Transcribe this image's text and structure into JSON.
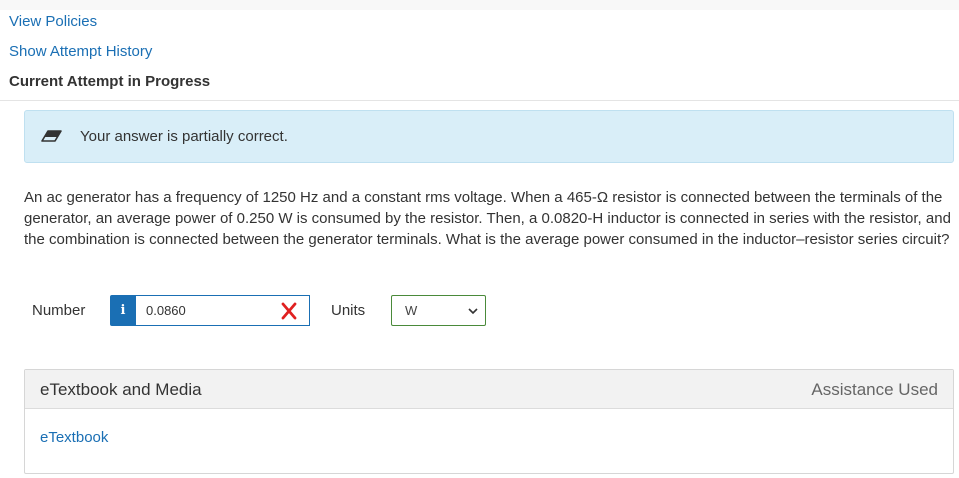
{
  "links": {
    "view_policies": "View Policies",
    "show_attempt_history": "Show Attempt History"
  },
  "attempt_heading": "Current Attempt in Progress",
  "alert": {
    "message": "Your answer is partially correct.",
    "icon": "pencil-icon"
  },
  "question": {
    "text": "An ac generator has a frequency of 1250 Hz and a constant rms voltage. When a 465-Ω resistor is connected between the terminals of the generator, an average power of 0.250 W is consumed by the resistor. Then, a 0.0820-H inductor is connected in series with the resistor, and the combination is connected between the generator terminals. What is the average power consumed in the inductor–resistor series circuit?"
  },
  "answer": {
    "number_label": "Number",
    "info_icon_glyph": "i",
    "value": "0.0860",
    "status_icon": "x-mark-icon",
    "units_label": "Units",
    "units_selected": "W"
  },
  "media": {
    "title": "eTextbook and Media",
    "assistance": "Assistance Used",
    "etextbook_link": "eTextbook"
  },
  "colors": {
    "link": "#1a6fb4",
    "alert_bg": "#d9eef8",
    "error": "#e02020",
    "select_border": "#4a8a3a"
  }
}
